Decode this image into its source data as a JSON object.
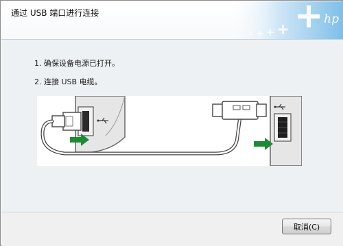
{
  "window": {
    "title": "通过 USB 端口进行连接",
    "brand_logo_text": "hp"
  },
  "steps": [
    {
      "label": "1. 确保设备电源已打开。"
    },
    {
      "label": "2. 连接 USB 电缆。"
    }
  ],
  "illustration": {
    "icon": "usb-cable-connection",
    "arrow_color": "#1f8a34"
  },
  "footer": {
    "cancel_label": "取消(C)"
  }
}
